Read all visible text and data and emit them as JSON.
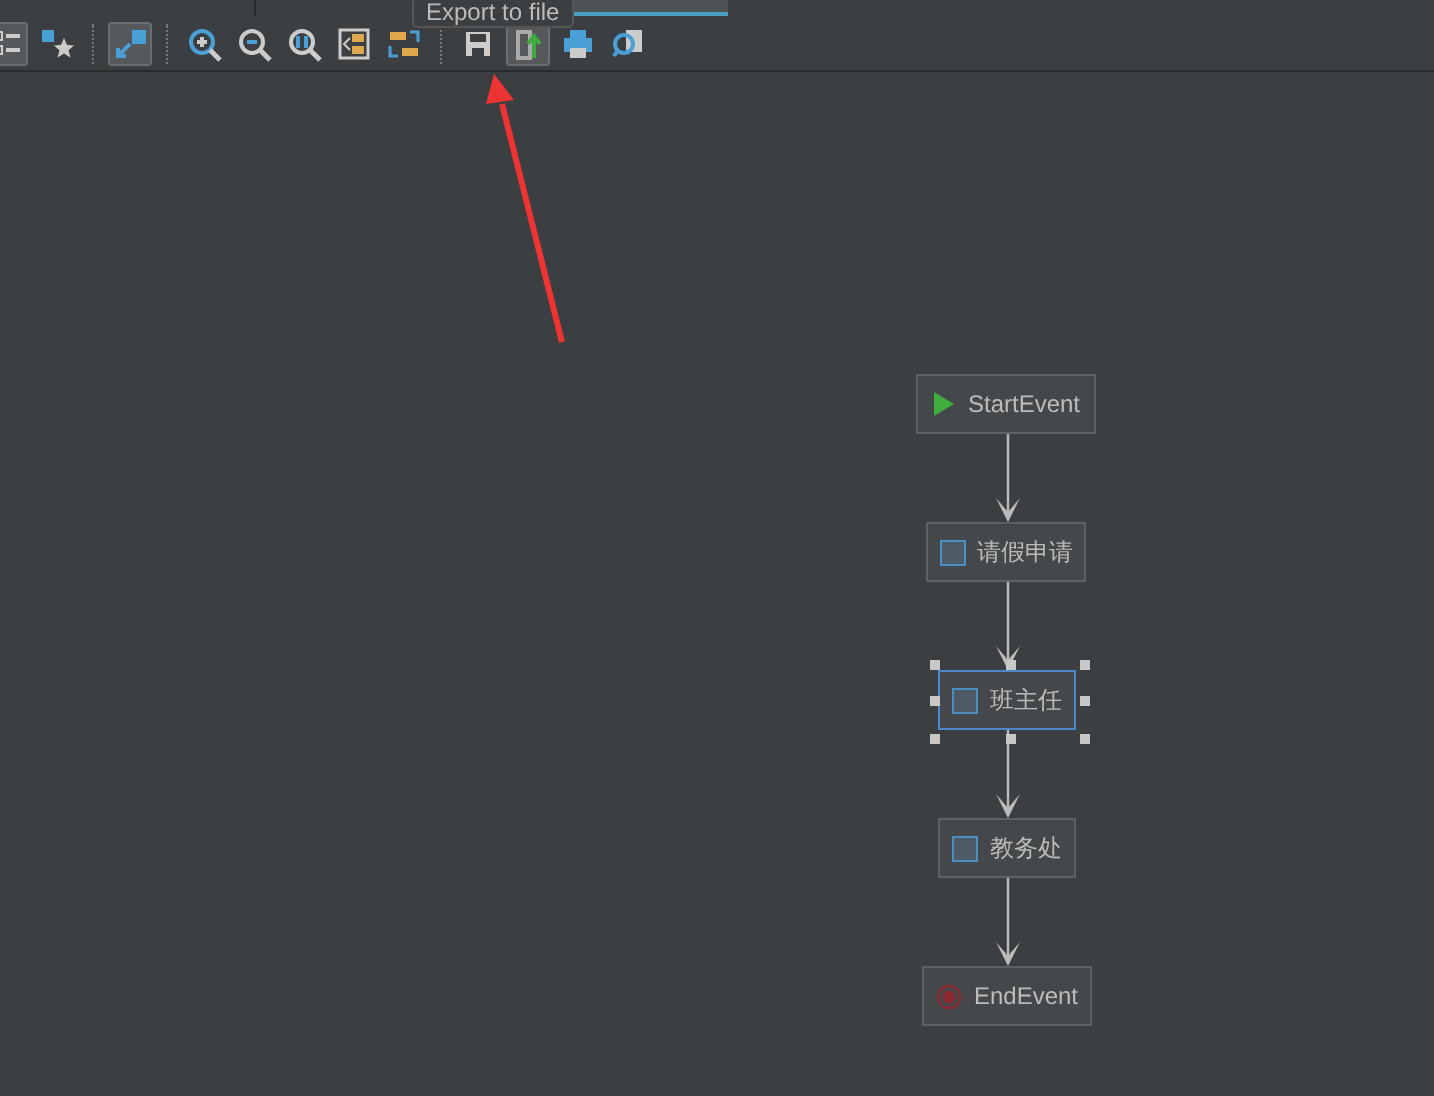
{
  "tabs": [
    {
      "selected": false
    },
    {
      "selected": false
    },
    {
      "selected": true
    }
  ],
  "toolbar": {
    "tooltip": "Export to file",
    "buttons": [
      {
        "kind": "list",
        "pressed": true
      },
      {
        "kind": "star",
        "pressed": false
      },
      {
        "kind": "sep"
      },
      {
        "kind": "arrows",
        "pressed": true
      },
      {
        "kind": "sep"
      },
      {
        "kind": "zoomin",
        "pressed": false
      },
      {
        "kind": "zoomout",
        "pressed": false
      },
      {
        "kind": "actual",
        "pressed": false
      },
      {
        "kind": "fit",
        "pressed": false
      },
      {
        "kind": "layout",
        "pressed": false
      },
      {
        "kind": "sep"
      },
      {
        "kind": "save",
        "pressed": false
      },
      {
        "kind": "export",
        "pressed": true
      },
      {
        "kind": "print",
        "pressed": false
      },
      {
        "kind": "preview",
        "pressed": false
      }
    ]
  },
  "nodes": [
    {
      "kind": "start",
      "label": "StartEvent",
      "selected": false
    },
    {
      "kind": "task",
      "label": "请假申请",
      "selected": false
    },
    {
      "kind": "task",
      "label": "班主任",
      "selected": true
    },
    {
      "kind": "task",
      "label": "教务处",
      "selected": false
    },
    {
      "kind": "end",
      "label": "EndEvent",
      "selected": false
    }
  ]
}
